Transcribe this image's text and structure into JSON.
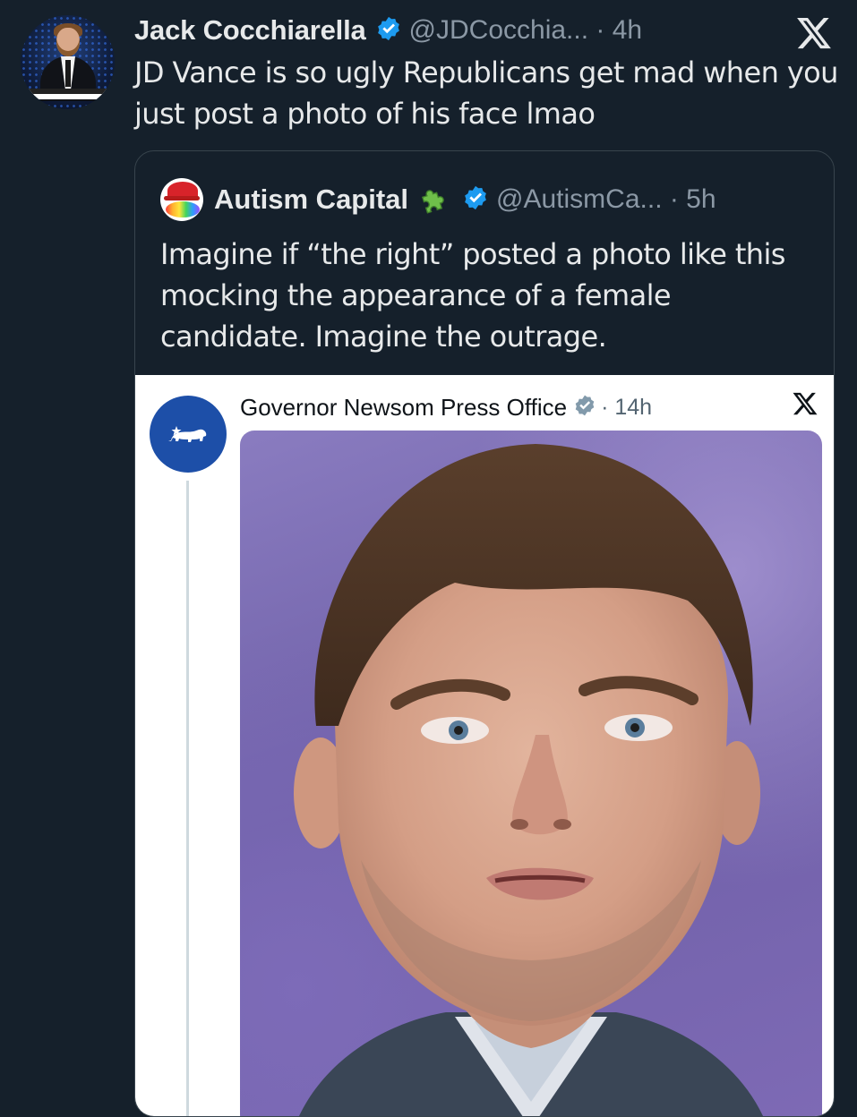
{
  "main_tweet": {
    "author_name": "Jack Cocchiarella",
    "handle_time": "@JDCocchia... · 4h",
    "text": "JD Vance is so ugly Republicans get mad when you just post a photo of his face lmao",
    "avatar_icon": "profile-photo",
    "platform_icon": "x-logo-icon"
  },
  "quoted_tweet": {
    "author_name": "Autism Capital",
    "badge_icon": "puzzle-piece-icon",
    "handle_time": "@AutismCa... · 5h",
    "text": "Imagine if “the right” posted a photo like this mocking the appearance of a female candidate. Imagine the outrage."
  },
  "embedded_post": {
    "author_name": "Governor Newsom Press Office",
    "time": "· 14h",
    "avatar_icon": "california-bear-icon",
    "platform_icon": "x-logo-icon",
    "photo": "portrait-photo"
  },
  "colors": {
    "background": "#15202b",
    "text_primary": "#e7e9ea",
    "text_secondary": "#8b98a5",
    "verified_blue": "#1d9bf0",
    "verified_gray": "#829aab",
    "embed_background": "#ffffff",
    "gov_avatar_blue": "#1d4fa8"
  }
}
